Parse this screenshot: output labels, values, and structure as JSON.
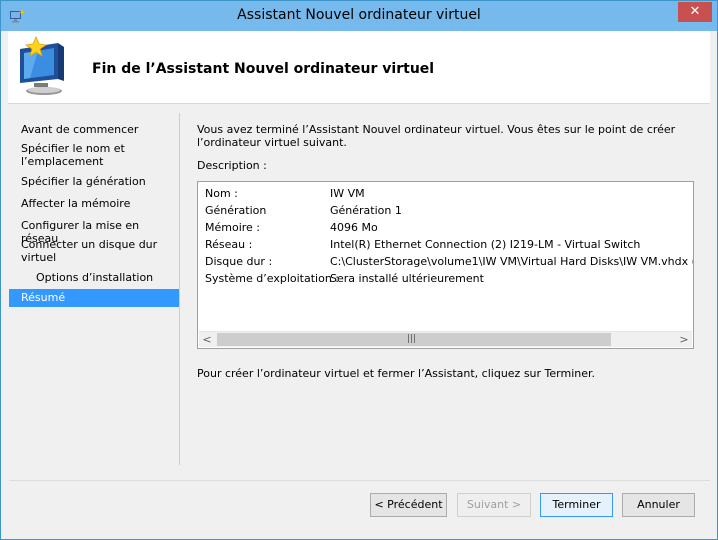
{
  "window": {
    "title": "Assistant Nouvel ordinateur virtuel",
    "close_label": "✕"
  },
  "header": {
    "title": "Fin de l’Assistant Nouvel ordinateur virtuel",
    "icon": "new-vm-wizard-icon"
  },
  "nav": {
    "items": [
      {
        "label": "Avant de commencer"
      },
      {
        "label": "Spécifier le nom et l’emplacement"
      },
      {
        "label": "Spécifier la génération"
      },
      {
        "label": "Affecter la mémoire"
      },
      {
        "label": "Configurer la mise en réseau"
      },
      {
        "label": "Connecter un disque dur virtuel"
      },
      {
        "label": "Options d’installation"
      },
      {
        "label": "Résumé"
      }
    ],
    "selected": "Résumé"
  },
  "main": {
    "intro": "Vous avez terminé l’Assistant Nouvel ordinateur virtuel. Vous êtes sur le point de créer l’ordinateur virtuel suivant.",
    "description_label": "Description :",
    "summary": [
      {
        "key": "Nom :",
        "value": "IW VM"
      },
      {
        "key": "Génération",
        "value": "Génération 1"
      },
      {
        "key": "Mémoire :",
        "value": "4096 Mo"
      },
      {
        "key": "Réseau :",
        "value": "Intel(R) Ethernet Connection (2) I219-LM - Virtual Switch"
      },
      {
        "key": "Disque dur :",
        "value": "C:\\ClusterStorage\\volume1\\IW VM\\Virtual Hard Disks\\IW VM.vhdx (VHDX, ta"
      },
      {
        "key": "Système d’exploitation :",
        "value": "Sera installé ultérieurement"
      }
    ],
    "outro": "Pour créer l’ordinateur virtuel et fermer l’Assistant, cliquez sur Terminer."
  },
  "buttons": {
    "previous": "< Précédent",
    "next": "Suivant >",
    "finish": "Terminer",
    "cancel": "Annuler"
  }
}
